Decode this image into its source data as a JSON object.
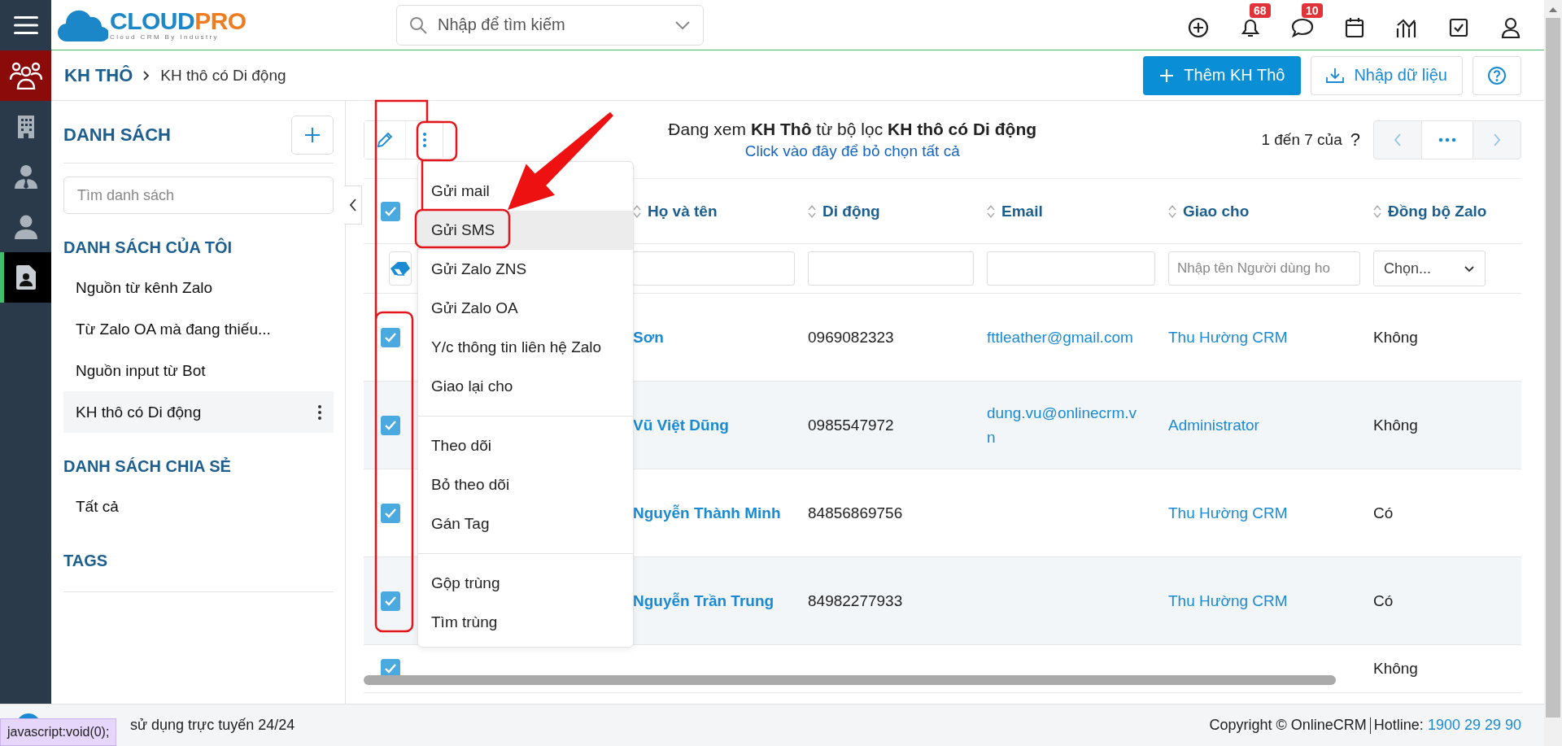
{
  "logo": {
    "name_a": "CLOUD",
    "name_b": "PRO",
    "tagline": "Cloud CRM By Industry"
  },
  "search": {
    "placeholder": "Nhập để tìm kiếm"
  },
  "top_icons": [
    {
      "kind": "add"
    },
    {
      "kind": "bell",
      "badge": "68"
    },
    {
      "kind": "chat",
      "badge": "10"
    },
    {
      "kind": "calendar"
    },
    {
      "kind": "chart"
    },
    {
      "kind": "task"
    },
    {
      "kind": "user"
    }
  ],
  "rail": [
    {
      "kind": "people",
      "selected": false
    },
    {
      "kind": "building",
      "selected": false
    },
    {
      "kind": "contact",
      "selected": false
    },
    {
      "kind": "person",
      "selected": false
    },
    {
      "kind": "card",
      "selected": true
    }
  ],
  "breadcrumb": [
    "KH THÔ",
    "KH thô có Di động"
  ],
  "actions": {
    "add": "Thêm KH Thô",
    "import": "Nhập dữ liệu"
  },
  "sidebar": {
    "title": "DANH SÁCH",
    "search_placeholder": "Tìm danh sách",
    "sections": [
      {
        "title": "DANH SÁCH CỦA TÔI",
        "items": [
          {
            "label": "Nguồn từ kênh Zalo",
            "selected": false
          },
          {
            "label": "Từ Zalo OA mà đang thiếu...",
            "selected": false
          },
          {
            "label": "Nguồn input từ Bot",
            "selected": false
          },
          {
            "label": "KH thô có Di động",
            "selected": true
          }
        ]
      },
      {
        "title": "DANH SÁCH CHIA SẺ",
        "items": [
          {
            "label": "Tất cả",
            "selected": false
          }
        ]
      },
      {
        "title": "TAGS"
      }
    ]
  },
  "toolbar": {
    "info": "Đang xem **KH Thô** từ bộ lọc **KH thô có Di động**",
    "clear_link": "Click vào đây để bỏ chọn tất cả",
    "range": "1 đến 7 của",
    "total": "?"
  },
  "menu": [
    [
      {
        "label": "Gửi mail",
        "selected": false
      },
      {
        "label": "Gửi SMS",
        "selected": true
      },
      {
        "label": "Gửi Zalo ZNS",
        "selected": false
      },
      {
        "label": "Gửi Zalo OA",
        "selected": false
      },
      {
        "label": "Y/c thông tin liên hệ Zalo",
        "selected": false
      },
      {
        "label": "Giao lại cho",
        "selected": false
      }
    ],
    [
      {
        "label": "Theo dõi",
        "selected": false
      },
      {
        "label": "Bỏ theo dõi",
        "selected": false
      },
      {
        "label": "Gán Tag",
        "selected": false
      }
    ],
    [
      {
        "label": "Gộp trùng",
        "selected": false
      },
      {
        "label": "Tìm trùng",
        "selected": false
      }
    ]
  ],
  "table": {
    "all_checked": true,
    "columns": [
      {
        "label": "Họ và tên"
      },
      {
        "label": "Di động"
      },
      {
        "label": "Email"
      },
      {
        "label": "Giao cho"
      },
      {
        "label": "Đồng bộ Zalo"
      }
    ],
    "filters": [
      {
        "kind": "text"
      },
      {
        "kind": "text"
      },
      {
        "kind": "text"
      },
      {
        "kind": "text",
        "placeholder": "Nhập tên Người dùng ho"
      },
      {
        "kind": "select",
        "placeholder": "Chọn..."
      }
    ],
    "rows": [
      {
        "checked": true,
        "name": "Sơn",
        "mobile": "0969082323",
        "email": "fttleather@gmail.com",
        "assignee": "Thu Hường CRM",
        "zalo": "Không"
      },
      {
        "checked": true,
        "name": "Vũ Việt Dũng",
        "mobile": "0985547972",
        "email": "dung.vu@onlinecrm.vn",
        "assignee": "Administrator",
        "zalo": "Không"
      },
      {
        "checked": true,
        "name": "Nguyễn Thành Minh",
        "mobile": "84856869756",
        "assignee": "Thu Hường CRM",
        "zalo": "Có"
      },
      {
        "checked": true,
        "name": "Nguyễn Trần Trung",
        "mobile": "84982277933",
        "assignee": "Thu Hường CRM",
        "zalo": "Có"
      },
      {
        "checked": true,
        "zalo": "Không"
      }
    ]
  },
  "footer": {
    "status": "sử dụng trực tuyến 24/24",
    "copyright": "Copyright © OnlineCRM",
    "hotline_label": "Hotline:",
    "hotline": "1900 29 29 90"
  },
  "tooltip": "javascript:void(0);"
}
